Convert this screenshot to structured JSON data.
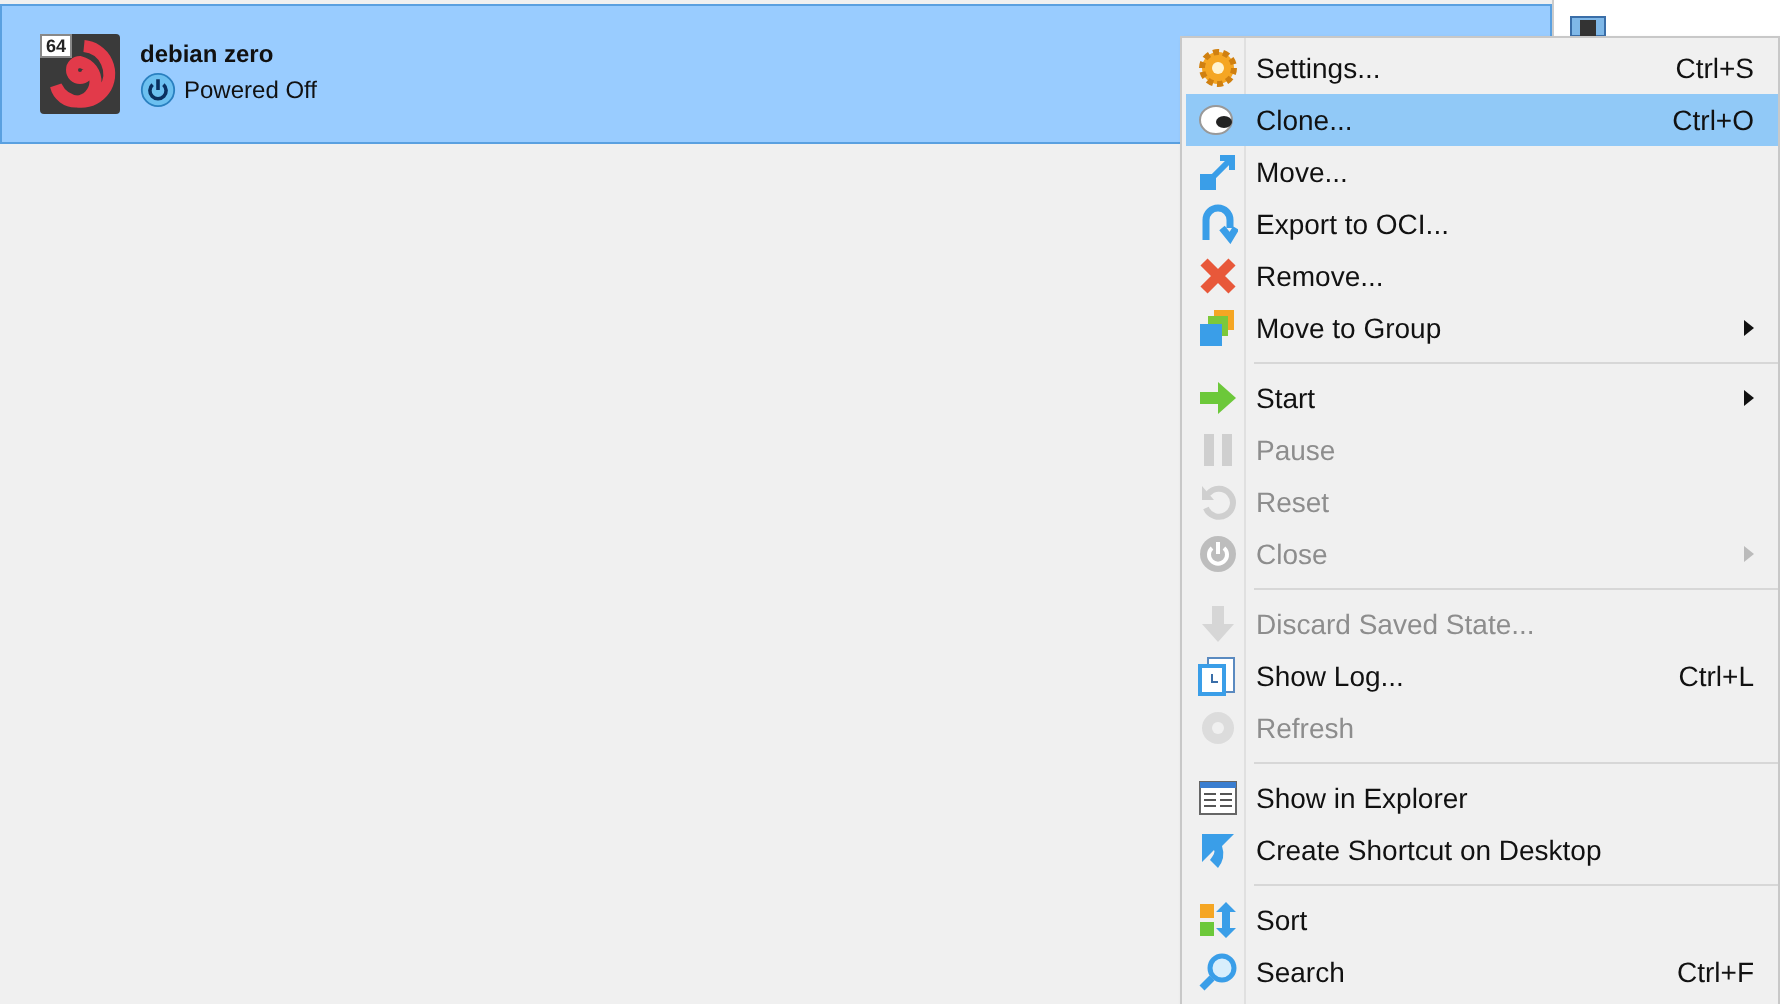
{
  "machines": [
    {
      "name": "debian zero",
      "badge": "64",
      "state": "Powered Off",
      "selected": true
    }
  ],
  "details_panel": {
    "kind": "panel"
  },
  "context_menu": [
    {
      "kind": "item",
      "label": "Settings...",
      "shortcut": "Ctrl+S",
      "submenu": false,
      "disabled": false,
      "selected": false
    },
    {
      "kind": "item",
      "label": "Clone...",
      "shortcut": "Ctrl+O",
      "submenu": false,
      "disabled": false,
      "selected": true
    },
    {
      "kind": "item",
      "label": "Move...",
      "submenu": false,
      "disabled": false,
      "selected": false
    },
    {
      "kind": "item",
      "label": "Export to OCI...",
      "submenu": false,
      "disabled": false,
      "selected": false
    },
    {
      "kind": "item",
      "label": "Remove...",
      "submenu": false,
      "disabled": false,
      "selected": false
    },
    {
      "kind": "item",
      "label": "Move to Group",
      "submenu": true,
      "disabled": false,
      "selected": false
    },
    {
      "kind": "separator"
    },
    {
      "kind": "item",
      "label": "Start",
      "submenu": true,
      "disabled": false,
      "selected": false
    },
    {
      "kind": "item",
      "label": "Pause",
      "submenu": false,
      "disabled": true,
      "selected": false
    },
    {
      "kind": "item",
      "label": "Reset",
      "submenu": false,
      "disabled": true,
      "selected": false
    },
    {
      "kind": "item",
      "label": "Close",
      "submenu": true,
      "disabled": true,
      "selected": false
    },
    {
      "kind": "separator"
    },
    {
      "kind": "item",
      "label": "Discard Saved State...",
      "submenu": false,
      "disabled": true,
      "selected": false
    },
    {
      "kind": "item",
      "label": "Show Log...",
      "shortcut": "Ctrl+L",
      "submenu": false,
      "disabled": false,
      "selected": false
    },
    {
      "kind": "item",
      "label": "Refresh",
      "submenu": false,
      "disabled": true,
      "selected": false
    },
    {
      "kind": "separator"
    },
    {
      "kind": "item",
      "label": "Show in Explorer",
      "submenu": false,
      "disabled": false,
      "selected": false
    },
    {
      "kind": "item",
      "label": "Create Shortcut on Desktop",
      "submenu": false,
      "disabled": false,
      "selected": false
    },
    {
      "kind": "separator"
    },
    {
      "kind": "item",
      "label": "Sort",
      "submenu": false,
      "disabled": false,
      "selected": false
    },
    {
      "kind": "item",
      "label": "Search",
      "shortcut": "Ctrl+F",
      "submenu": false,
      "disabled": false,
      "selected": false
    }
  ]
}
